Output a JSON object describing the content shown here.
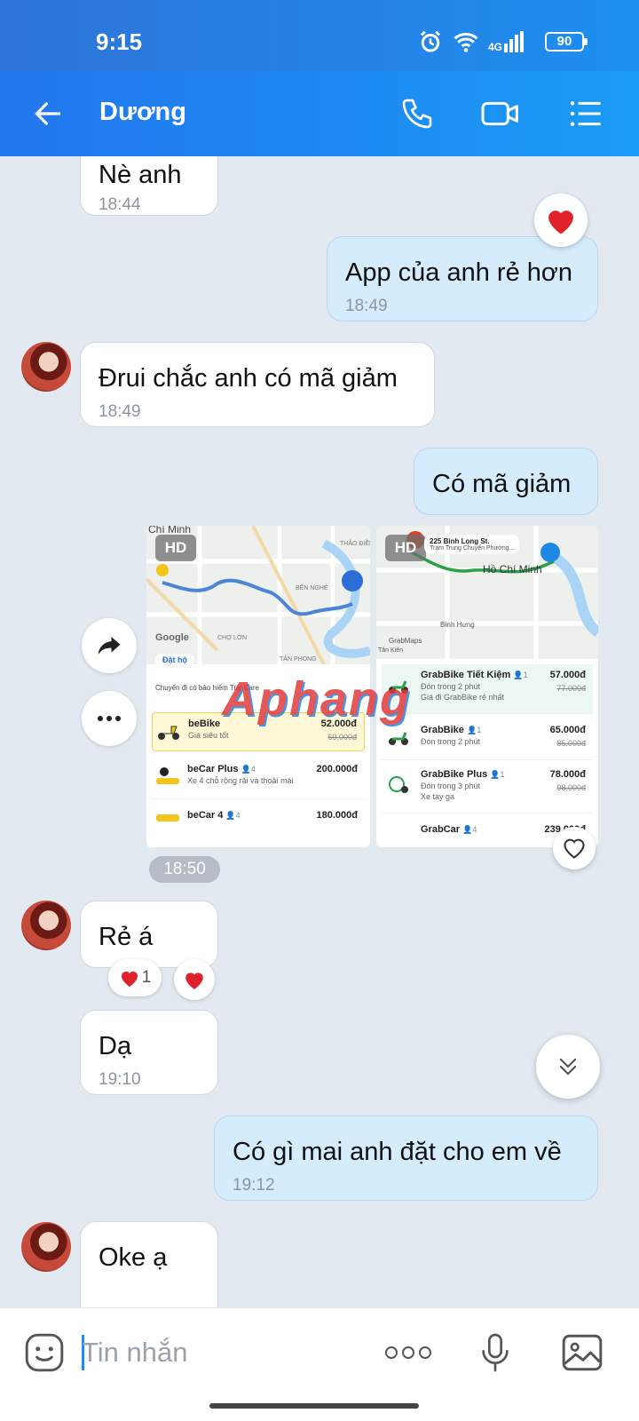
{
  "status_bar": {
    "time": "9:15",
    "network": "4G",
    "battery": "90"
  },
  "header": {
    "contact_name": "Dương"
  },
  "messages": [
    {
      "side": "in",
      "text": "Nè anh",
      "time": "18:44"
    },
    {
      "side": "out",
      "text": "App của anh rẻ hơn",
      "time": "18:49"
    },
    {
      "side": "in",
      "text": "Đrui chắc anh có mã giảm",
      "time": "18:49"
    },
    {
      "side": "out",
      "text": "Có mã giảm"
    },
    {
      "side": "in",
      "text": "Rẻ á",
      "reaction_count": "1"
    },
    {
      "side": "in",
      "text": "Dạ",
      "time": "19:10"
    },
    {
      "side": "out",
      "text": "Có gì mai anh đặt cho em về",
      "time": "19:12"
    },
    {
      "side": "in",
      "text": "Oke ạ"
    }
  ],
  "image_time_pill": "18:50",
  "shared_images": {
    "hd_label": "HD",
    "be": {
      "map_labels": [
        "Chí Minh",
        "BẾN NGHÉ",
        "CHỢ LỚN",
        "THẢO ĐIỀN",
        "TÂN PHONG"
      ],
      "google_label": "Google",
      "book_for": "Đặt hộ",
      "insurance_note": "Chuyến đi có bảo hiểm Trip Care",
      "rides": [
        {
          "name": "beBike",
          "sub": "Giá siêu tốt",
          "price": "52.000đ",
          "old": "69.000đ"
        },
        {
          "name": "beCar Plus",
          "seats": "4",
          "sub": "Xe 4 chỗ rộng rãi và thoải mái",
          "price": "200.000đ"
        },
        {
          "name": "beCar 4",
          "seats": "4",
          "price": "180.000đ"
        }
      ]
    },
    "grab": {
      "address": "225 Bình Long St.",
      "sub_address": "Trạm Trung Chuyển Phường...",
      "city": "Hồ Chí Minh",
      "map_labels": [
        "Bình Hưng",
        "Tân Kiên",
        "GrabMaps"
      ],
      "rides": [
        {
          "name": "GrabBike Tiết Kiệm",
          "seats": "1",
          "sub": "Đón trong 2 phút",
          "note": "Giá đi GrabBike rẻ nhất",
          "price": "57.000đ",
          "old": "77.000đ"
        },
        {
          "name": "GrabBike",
          "seats": "1",
          "sub": "Đón trong 2 phút",
          "price": "65.000đ",
          "old": "85.000đ"
        },
        {
          "name": "GrabBike Plus",
          "seats": "1",
          "sub": "Đón trong 3 phút",
          "note": "Xe tay ga",
          "price": "78.000đ",
          "old": "98.000đ"
        },
        {
          "name": "GrabCar",
          "seats": "4",
          "price": "239.000đ"
        }
      ]
    }
  },
  "watermark": "Aphang",
  "input": {
    "placeholder": "Tin nhắn"
  },
  "colors": {
    "header": "#1f86f0",
    "out_bubble": "#d5ecfd",
    "heart": "#e0222d"
  }
}
